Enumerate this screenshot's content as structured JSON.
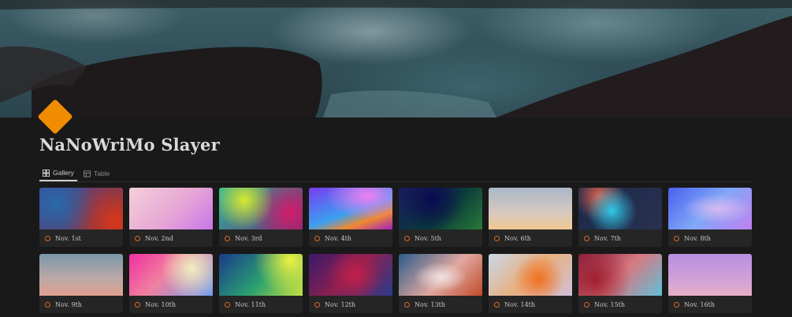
{
  "page": {
    "title": "NaNoWriMo Slayer",
    "icon": "orange-diamond-icon"
  },
  "views": [
    {
      "label": "Gallery",
      "icon": "gallery-grid-icon",
      "active": true
    },
    {
      "label": "Table",
      "icon": "table-icon",
      "active": false
    }
  ],
  "cards": [
    {
      "label": "Nov. 1st"
    },
    {
      "label": "Nov. 2nd"
    },
    {
      "label": "Nov. 3rd"
    },
    {
      "label": "Nov. 4th"
    },
    {
      "label": "Nov. 5th"
    },
    {
      "label": "Nov. 6th"
    },
    {
      "label": "Nov. 7th"
    },
    {
      "label": "Nov. 8th"
    },
    {
      "label": "Nov. 9th"
    },
    {
      "label": "Nov. 10th"
    },
    {
      "label": "Nov. 11th"
    },
    {
      "label": "Nov. 12th"
    },
    {
      "label": "Nov. 13th"
    },
    {
      "label": "Nov. 14th"
    },
    {
      "label": "Nov. 15th"
    },
    {
      "label": "Nov. 16th"
    }
  ],
  "colors": {
    "background": "#191919",
    "card": "#252525",
    "accent": "#f08c00",
    "status": "#d86a2a"
  }
}
